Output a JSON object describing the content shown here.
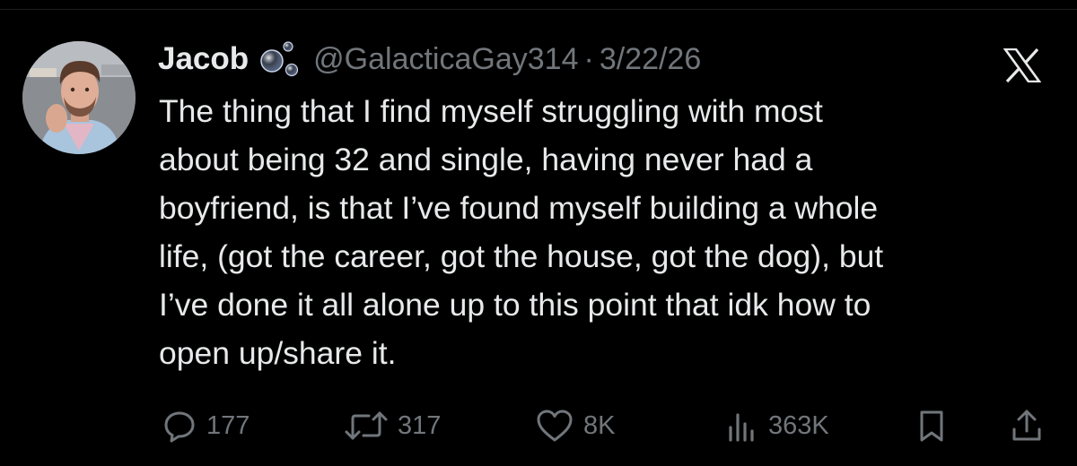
{
  "tweet": {
    "author_name": "Jacob",
    "handle": "@GalacticaGay314",
    "separator": "·",
    "date": "3/22/26",
    "text_lines": [
      "The thing that I find myself struggling with most",
      "about being 32 and single, having never had a",
      "boyfriend, is that I’ve found myself building a whole",
      "life, (got the career, got the house, got the dog), but",
      "I’ve done it all alone up to this point that idk how to",
      "open up/share it."
    ]
  },
  "actions": {
    "reply_count": "177",
    "repost_count": "317",
    "like_count": "8K",
    "view_count": "363K"
  },
  "icons": {
    "reply": "reply-icon",
    "repost": "repost-icon",
    "like": "heart-icon",
    "views": "views-icon",
    "bookmark": "bookmark-icon",
    "share": "share-icon",
    "platform": "x-logo-icon",
    "profile_emoji": "bubbles-icon"
  },
  "colors": {
    "background": "#000000",
    "text": "#e7e9ea",
    "muted": "#71767b"
  }
}
